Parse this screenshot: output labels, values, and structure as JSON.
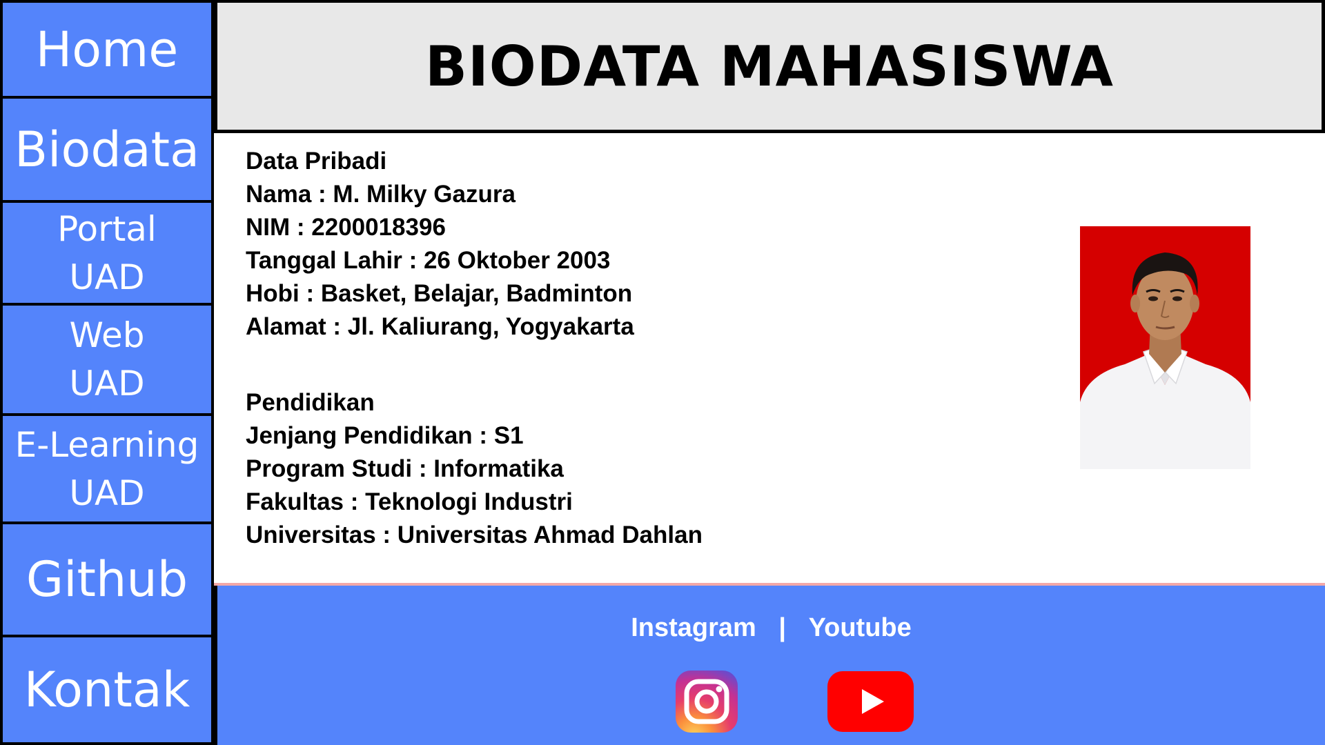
{
  "sidebar": {
    "items": [
      {
        "lines": [
          "Home"
        ]
      },
      {
        "lines": [
          "Biodata"
        ]
      },
      {
        "lines": [
          "Portal",
          "UAD"
        ]
      },
      {
        "lines": [
          "Web",
          "UAD"
        ]
      },
      {
        "lines": [
          "E-Learning",
          "UAD"
        ]
      },
      {
        "lines": [
          "Github"
        ]
      },
      {
        "lines": [
          "Kontak"
        ]
      }
    ]
  },
  "header": {
    "title": "BIODATA MAHASISWA"
  },
  "personal": {
    "heading": "Data Pribadi",
    "name": "Nama : M. Milky Gazura",
    "nim": "NIM : 2200018396",
    "birth": "Tanggal Lahir : 26 Oktober 2003",
    "hobby": "Hobi : Basket, Belajar, Badminton",
    "address": "Alamat : Jl. Kaliurang, Yogyakarta"
  },
  "education": {
    "heading": "Pendidikan",
    "level": "Jenjang Pendidikan : S1",
    "program": "Program Studi : Informatika",
    "faculty": "Fakultas : Teknologi Industri",
    "university": "Universitas : Universitas Ahmad Dahlan"
  },
  "photo": {
    "background_color": "#d50000"
  },
  "footer": {
    "instagram_label": "Instagram",
    "separator": "|",
    "youtube_label": "Youtube",
    "icons": [
      "instagram-icon",
      "youtube-icon"
    ]
  },
  "colors": {
    "nav_blue": "#5484fb",
    "header_bg": "#e8e8e8",
    "youtube_red": "#ff0000"
  }
}
